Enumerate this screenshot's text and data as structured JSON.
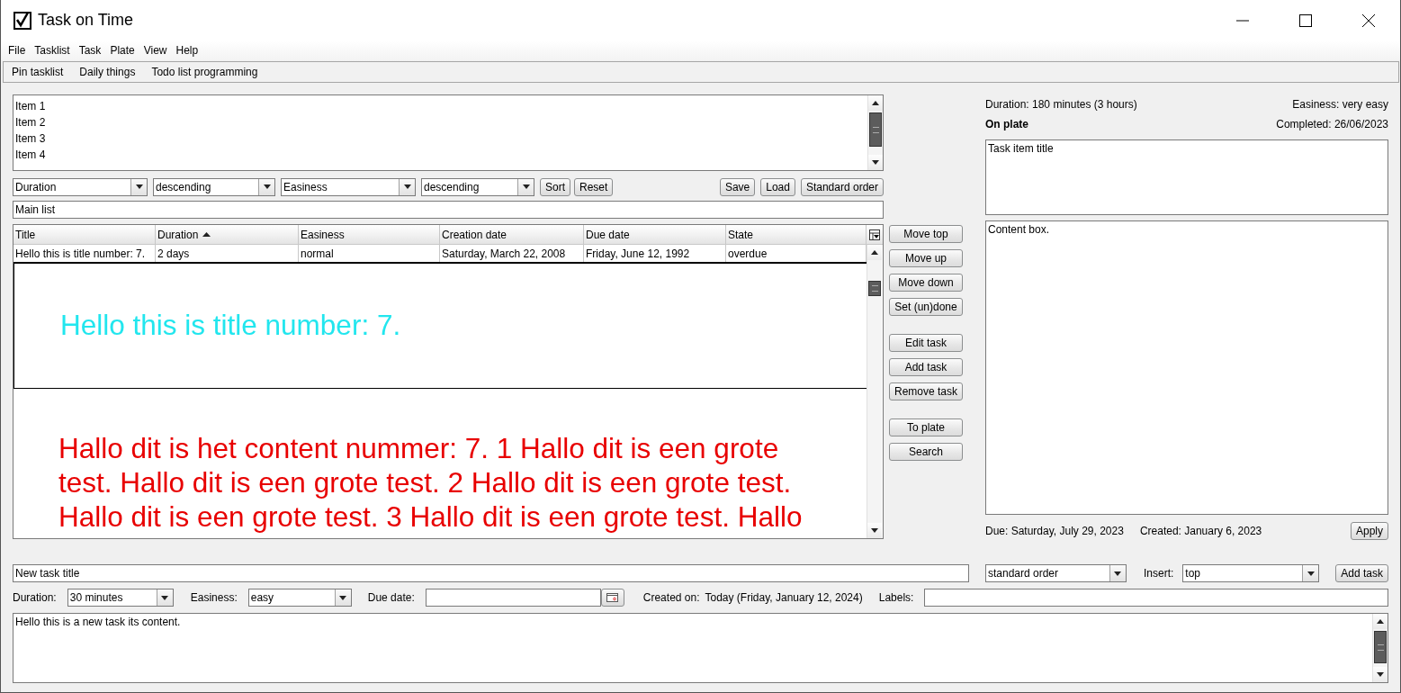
{
  "window": {
    "title": "Task on Time"
  },
  "menu": [
    "File",
    "Tasklist",
    "Task",
    "Plate",
    "View",
    "Help"
  ],
  "tasklists": [
    "Pin tasklist",
    "Daily things",
    "Todo list programming"
  ],
  "list_items": [
    "Item 1",
    "Item 2",
    "Item 3",
    "Item 4"
  ],
  "sort_bar": {
    "fields": [
      "Duration",
      "descending",
      "Easiness",
      "descending"
    ],
    "buttons": [
      "Sort",
      "Reset"
    ],
    "file_buttons": [
      "Save",
      "Load",
      "Standard order"
    ]
  },
  "list_name": "Main list",
  "table": {
    "columns": [
      {
        "label": "Title",
        "sorted": false
      },
      {
        "label": "Duration",
        "sorted": true
      },
      {
        "label": "Easiness",
        "sorted": false
      },
      {
        "label": "Creation date",
        "sorted": false
      },
      {
        "label": "Due date",
        "sorted": false
      },
      {
        "label": "State",
        "sorted": false
      }
    ],
    "rows": [
      {
        "cells": [
          "Hello this is title number: 7.",
          "2 days",
          "normal",
          "Saturday, March 22, 2008",
          "Friday, June 12, 1992",
          "overdue"
        ],
        "preview": {
          "title": "Hello this is title number: 7.",
          "content": "Hallo dit is het content nummer: 7. 1 Hallo dit is een grote test. Hallo dit is een grote test. 2 Hallo dit is een grote test. Hallo dit is een grote test. 3 Hallo dit is een grote test. Hallo"
        }
      }
    ]
  },
  "action_groups": [
    [
      "Move top",
      "Move up",
      "Move down",
      "Set (un)done"
    ],
    [
      "Edit task",
      "Add task",
      "Remove task"
    ],
    [
      "To plate",
      "Search"
    ]
  ],
  "details": {
    "duration": "Duration: 180 minutes (3 hours)",
    "easiness": "Easiness: very easy",
    "status": "On plate",
    "completed": "Completed: 26/06/2023",
    "title": "Task item title",
    "content": "Content box.",
    "due": "Due: Saturday, July 29, 2023",
    "created": "Created: January 6, 2023",
    "apply": "Apply"
  },
  "new_task": {
    "title": "New task title",
    "order": "standard order",
    "insert_label": "Insert:",
    "insert": "top",
    "add_button": "Add task",
    "duration_label": "Duration:",
    "duration": "30 minutes",
    "easiness_label": "Easiness:",
    "easiness": "easy",
    "due_label": "Due date:",
    "created_label": "Created on:",
    "created": "Today (Friday, January 12, 2024)",
    "labels_label": "Labels:",
    "content": "Hello this is a new task its content."
  }
}
